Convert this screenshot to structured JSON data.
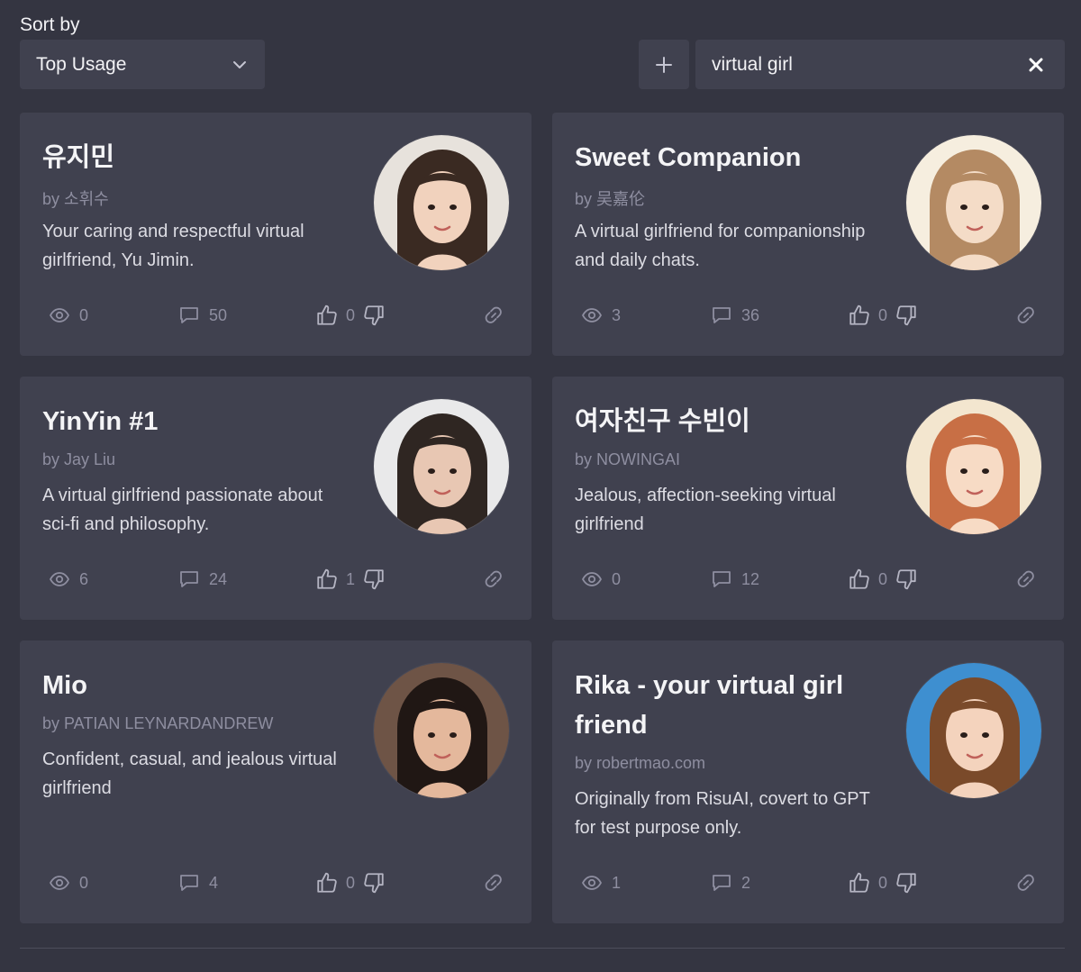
{
  "sort": {
    "label": "Sort by",
    "selected": "Top Usage"
  },
  "search": {
    "value": "virtual girl",
    "add_icon": "plus-icon",
    "clear_icon": "close-icon"
  },
  "cards": [
    {
      "name": "유지민",
      "author": "by 소휘수",
      "description": "Your caring and respectful virtual girlfriend, Yu Jimin.",
      "views": "0",
      "chats": "50",
      "likes": "0",
      "avatar_colors": [
        "#e7e2dc",
        "#3a2a22",
        "#f1d2bd"
      ]
    },
    {
      "name": "Sweet Companion",
      "author": "by 吴嘉伦",
      "description": "A virtual girlfriend for companionship and daily chats.",
      "views": "3",
      "chats": "36",
      "likes": "0",
      "avatar_colors": [
        "#f6eedf",
        "#b48a63",
        "#f4dcc7"
      ]
    },
    {
      "name": "YinYin #1",
      "author": "by Jay Liu",
      "description": "A virtual girlfriend passionate about sci-fi and philosophy.",
      "views": "6",
      "chats": "24",
      "likes": "1",
      "avatar_colors": [
        "#e9e9ea",
        "#2f2622",
        "#e8c7b3"
      ]
    },
    {
      "name": "여자친구 수빈이",
      "author": "by NOWINGAI",
      "description": "Jealous, affection-seeking virtual girlfriend",
      "views": "0",
      "chats": "12",
      "likes": "0",
      "avatar_colors": [
        "#f3e6cf",
        "#c86f45",
        "#f7dbc5"
      ]
    },
    {
      "name": "Mio",
      "author": "by PATIAN LEYNARDANDREW",
      "description": "Confident, casual, and jealous virtual girlfriend",
      "views": "0",
      "chats": "4",
      "likes": "0",
      "avatar_colors": [
        "#6e5446",
        "#201714",
        "#e4b89c"
      ]
    },
    {
      "name": "Rika - your virtual girl friend",
      "author": "by robertmao.com",
      "description": "Originally from RisuAI, covert to GPT for test purpose only.",
      "views": "1",
      "chats": "2",
      "likes": "0",
      "avatar_colors": [
        "#3e8fd0",
        "#7a4a2a",
        "#f4d3bd"
      ]
    }
  ],
  "icons": {
    "views": "eye-icon",
    "chats": "chat-bubble-icon",
    "like": "thumbs-up-icon",
    "dislike": "thumbs-down-icon",
    "share": "link-icon"
  }
}
